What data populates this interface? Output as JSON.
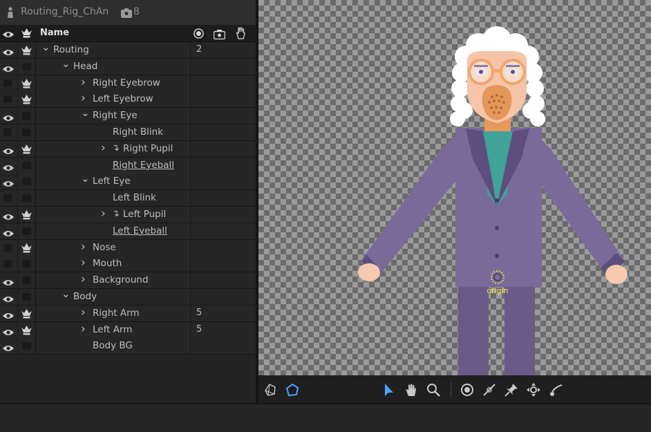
{
  "panel": {
    "title": "Routing_Rig_ChAn",
    "badge_count": "8",
    "header_name": "Name"
  },
  "rows": [
    {
      "label": "Routing",
      "eye": true,
      "crown": true,
      "indent": 0,
      "chevron": "down",
      "count": "2"
    },
    {
      "label": "Head",
      "eye": true,
      "crown": false,
      "indent": 1,
      "chevron": "down",
      "count": ""
    },
    {
      "label": "Right Eyebrow",
      "eye": false,
      "crown": true,
      "indent": 2,
      "chevron": "right",
      "count": ""
    },
    {
      "label": "Left Eyebrow",
      "eye": false,
      "crown": true,
      "indent": 2,
      "chevron": "right",
      "count": ""
    },
    {
      "label": "Right Eye",
      "eye": true,
      "crown": false,
      "indent": 2,
      "chevron": "down",
      "count": ""
    },
    {
      "label": "Right Blink",
      "eye": false,
      "crown": false,
      "indent": 3,
      "chevron": "",
      "count": ""
    },
    {
      "label": "Right Pupil",
      "eye": true,
      "crown": true,
      "indent": 3,
      "chevron": "right",
      "arrow": true,
      "count": ""
    },
    {
      "label": "Right Eyeball",
      "eye": true,
      "crown": false,
      "indent": 3,
      "chevron": "",
      "underline": true,
      "count": ""
    },
    {
      "label": "Left Eye",
      "eye": true,
      "crown": false,
      "indent": 2,
      "chevron": "down",
      "count": ""
    },
    {
      "label": "Left Blink",
      "eye": false,
      "crown": false,
      "indent": 3,
      "chevron": "",
      "count": ""
    },
    {
      "label": "Left Pupil",
      "eye": true,
      "crown": true,
      "indent": 3,
      "chevron": "right",
      "arrow": true,
      "count": ""
    },
    {
      "label": "Left Eyeball",
      "eye": true,
      "crown": false,
      "indent": 3,
      "chevron": "",
      "underline": true,
      "count": ""
    },
    {
      "label": "Nose",
      "eye": false,
      "crown": true,
      "indent": 2,
      "chevron": "right",
      "count": ""
    },
    {
      "label": "Mouth",
      "eye": false,
      "crown": false,
      "indent": 2,
      "chevron": "right",
      "count": ""
    },
    {
      "label": "Background",
      "eye": true,
      "crown": false,
      "indent": 2,
      "chevron": "right",
      "count": ""
    },
    {
      "label": "Body",
      "eye": true,
      "crown": false,
      "indent": 1,
      "chevron": "down",
      "count": ""
    },
    {
      "label": "Right Arm",
      "eye": true,
      "crown": true,
      "indent": 2,
      "chevron": "right",
      "count": "5"
    },
    {
      "label": "Left Arm",
      "eye": true,
      "crown": true,
      "indent": 2,
      "chevron": "right",
      "count": "5"
    },
    {
      "label": "Body BG",
      "eye": true,
      "crown": false,
      "indent": 2,
      "chevron": "",
      "count": ""
    }
  ],
  "canvas": {
    "origin_label": "origin"
  },
  "colors": {
    "accent": "#4aa3ff",
    "suit": "#7a6a9a",
    "skin": "#f4b183"
  }
}
